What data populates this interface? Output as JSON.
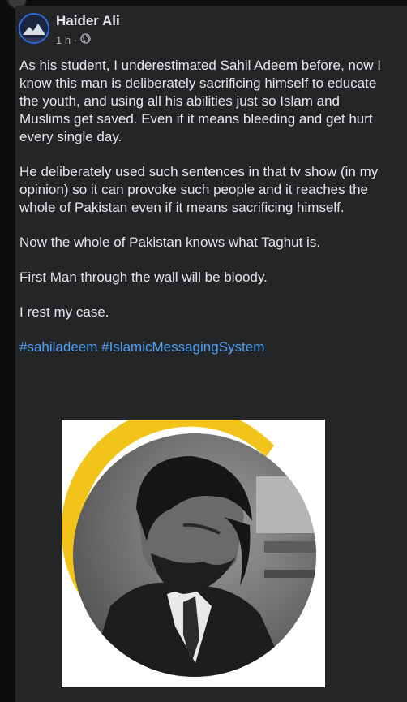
{
  "post": {
    "author": "Haider Ali",
    "timestamp": "1 h ·",
    "paragraphs": [
      "As his student, I underestimated Sahil Adeem before, now I know this man is deliberately sacrificing himself to educate the youth, and using all his abilities just so Islam and Muslims get saved. Even if it means bleeding and get hurt every single day.",
      "He deliberately used such sentences in that tv show (in my opinion) so it can provoke such people and it reaches the whole of Pakistan even if it means sacrificing himself.",
      "Now the whole of Pakistan knows what Taghut is.",
      "First Man through the wall will be bloody.",
      "I rest my case."
    ],
    "hashtags": [
      "#sahiladeem",
      "#IslamicMessagingSystem"
    ]
  },
  "icons": {
    "privacy": "globe-icon",
    "avatar": "profile-avatar-icon"
  },
  "colors": {
    "card_background": "#242526",
    "text": "#e4e6eb",
    "secondary_text": "#b0b3b8",
    "hashtag": "#4f9cf5",
    "photo_ring": "#f2c318"
  }
}
